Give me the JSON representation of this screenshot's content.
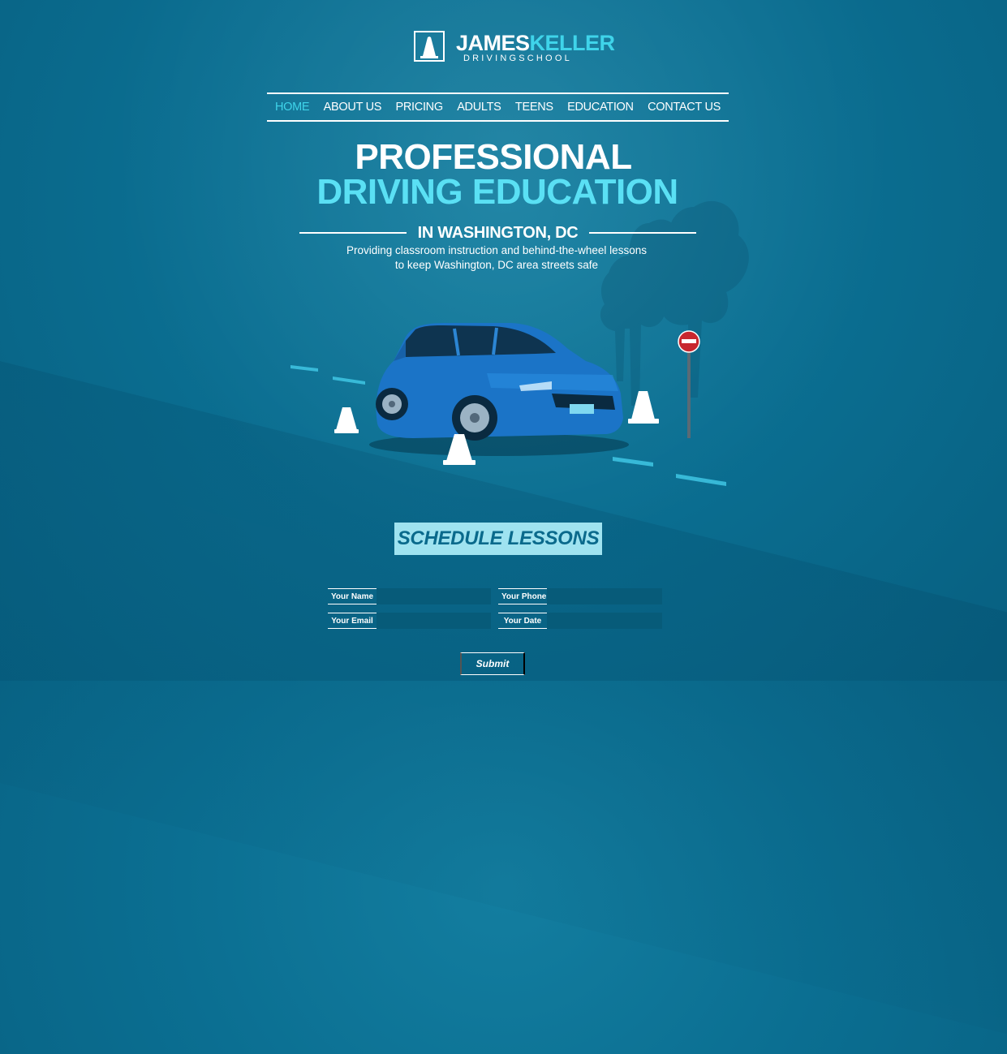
{
  "brand": {
    "name_first": "JAMES",
    "name_last": "KELLER",
    "subtitle": "DRIVINGSCHOOL",
    "logo_icon": "traffic-cone-icon"
  },
  "nav": {
    "items": [
      {
        "label": "HOME",
        "active": true
      },
      {
        "label": "ABOUT US"
      },
      {
        "label": "PRICING"
      },
      {
        "label": "ADULTS"
      },
      {
        "label": "TEENS"
      },
      {
        "label": "EDUCATION"
      },
      {
        "label": "CONTACT US"
      }
    ]
  },
  "hero": {
    "title_line1": "PROFESSIONAL",
    "title_line2": "DRIVING EDUCATION",
    "location": "IN WASHINGTON, DC",
    "tagline_line1": "Providing classroom instruction and behind-the-wheel lessons",
    "tagline_line2": "to keep Washington, DC area streets safe"
  },
  "schedule": {
    "heading": "SCHEDULE LESSONS",
    "fields": {
      "name_label": "Your Name",
      "phone_label": "Your Phone",
      "email_label": "Your Email",
      "date_label": "Your Date"
    },
    "submit_label": "Submit"
  },
  "colors": {
    "accent": "#3fd4ea",
    "background": "#0b6f92",
    "badge": "#9fe3f0"
  }
}
